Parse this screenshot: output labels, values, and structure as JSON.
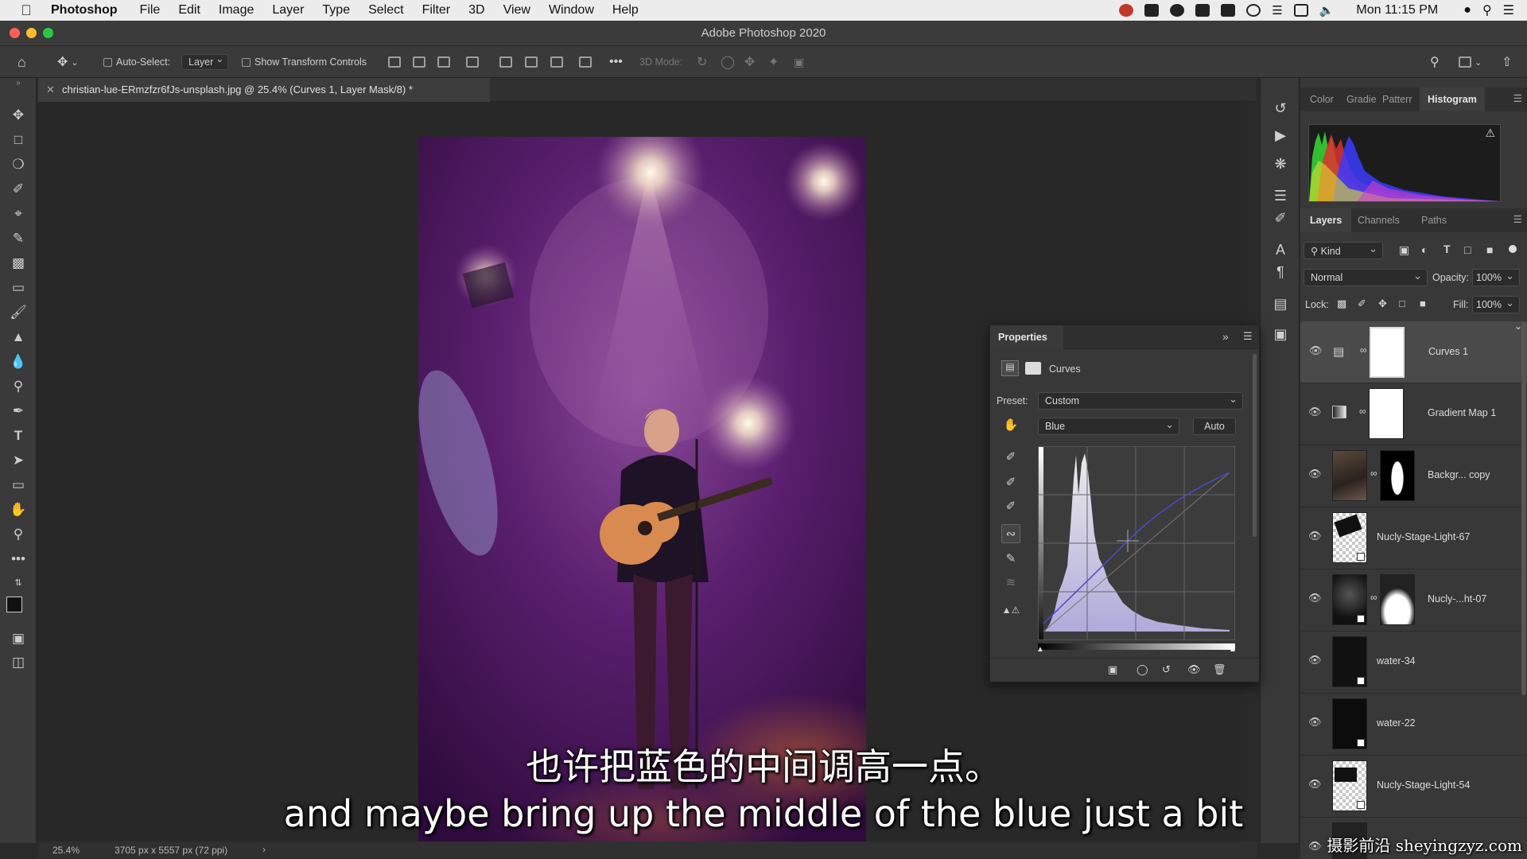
{
  "menubar": {
    "app": "Photoshop",
    "items": [
      "File",
      "Edit",
      "Image",
      "Layer",
      "Type",
      "Select",
      "Filter",
      "3D",
      "View",
      "Window",
      "Help"
    ],
    "clock": "Mon 11:15 PM"
  },
  "window": {
    "title": "Adobe Photoshop 2020"
  },
  "options": {
    "auto_select_label": "Auto-Select:",
    "auto_select_value": "Layer",
    "show_transform_label": "Show Transform Controls",
    "mode_3d_label": "3D Mode:"
  },
  "document": {
    "tab_title": "christian-lue-ERmzfzr6fJs-unsplash.jpg @ 25.4% (Curves 1, Layer Mask/8) *",
    "zoom": "25.4%",
    "dimensions": "3705 px x 5557 px (72 ppi)"
  },
  "panels": {
    "top_tabs": [
      "Color",
      "Gradie",
      "Patterr",
      "Histogram"
    ],
    "layer_tabs": [
      "Layers",
      "Channels",
      "Paths"
    ],
    "kind_label": "Kind",
    "blend_mode": "Normal",
    "opacity_label": "Opacity:",
    "opacity_value": "100%",
    "lock_label": "Lock:",
    "fill_label": "Fill:",
    "fill_value": "100%"
  },
  "layers": [
    {
      "name": "Curves 1",
      "selected": true
    },
    {
      "name": "Gradient Map 1",
      "selected": false
    },
    {
      "name": "Backgr... copy",
      "selected": false
    },
    {
      "name": "Nucly-Stage-Light-67",
      "selected": false
    },
    {
      "name": "Nucly-...ht-07",
      "selected": false
    },
    {
      "name": "water-34",
      "selected": false
    },
    {
      "name": "water-22",
      "selected": false
    },
    {
      "name": "Nucly-Stage-Light-54",
      "selected": false
    }
  ],
  "properties": {
    "title": "Properties",
    "adjustment": "Curves",
    "preset_label": "Preset:",
    "preset_value": "Custom",
    "channel_value": "Blue",
    "auto_label": "Auto"
  },
  "subtitles": {
    "chinese": "也许把蓝色的中间调高一点。",
    "english": "and maybe bring up the middle of the blue just a bit"
  },
  "watermark": "摄影前沿 sheyingzyz.com",
  "colors": {
    "accent_blue_curve": "#4a4ad0",
    "histogram_fill": "#c7c2ee",
    "photo_purple": "#5a1f6e"
  }
}
